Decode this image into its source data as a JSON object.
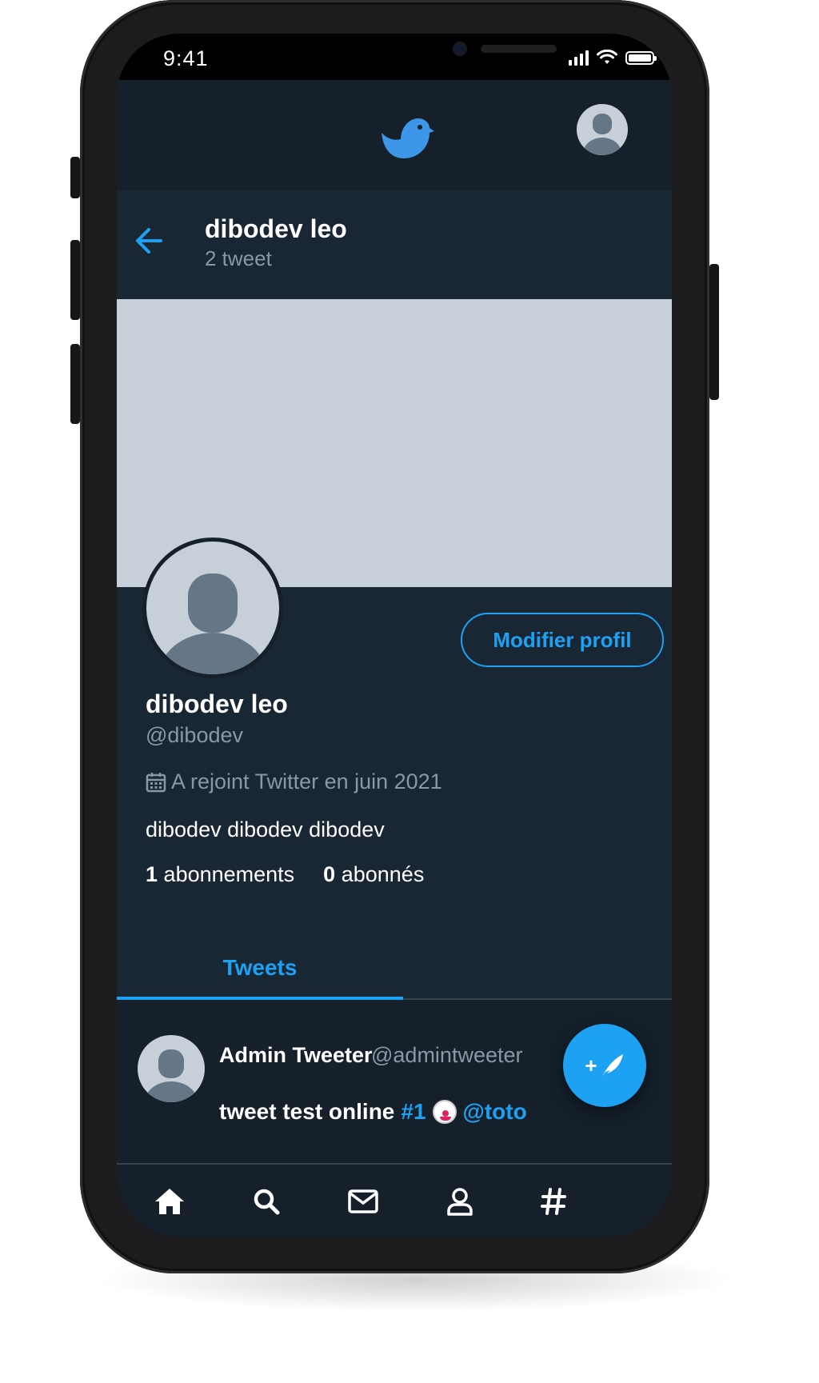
{
  "status_bar": {
    "time": "9:41"
  },
  "header": {
    "logo_icon": "bird-logo-icon",
    "avatar_icon": "user-avatar-icon"
  },
  "profile_header": {
    "name": "dibodev leo",
    "tweet_count": "2 tweet"
  },
  "profile": {
    "display_name": "dibodev leo",
    "handle": "@dibodev",
    "joined": "A rejoint Twitter en juin 2021",
    "bio": "dibodev dibodev dibodev",
    "following_count": "1",
    "following_label": "abonnements",
    "followers_count": "0",
    "followers_label": "abonnés",
    "edit_button": "Modifier profil"
  },
  "tabs": [
    {
      "label": "Tweets",
      "active": true
    }
  ],
  "tweets": [
    {
      "author": "Admin Tweeter",
      "handle": "@admintweeter",
      "text_prefix": "tweet test online",
      "hashtag": "#1",
      "emoji_icon": "clown-face-icon",
      "mention": "@toto"
    }
  ],
  "fab": {
    "icon": "compose-feather-icon",
    "label": "+"
  },
  "bottom_nav": [
    "home-icon",
    "search-icon",
    "mail-icon",
    "profile-icon",
    "hashtag-icon"
  ],
  "colors": {
    "accent": "#1da1f2",
    "background": "#15202b",
    "surface": "#192734",
    "muted": "#8899a6",
    "banner": "#c7d0d8"
  }
}
